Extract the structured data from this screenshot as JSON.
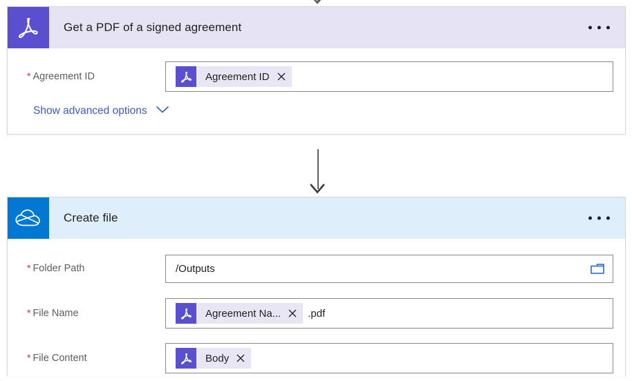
{
  "flow": {
    "cards": [
      {
        "id": "get-pdf-signed-agreement",
        "title": "Get a PDF of a signed agreement",
        "connector": "adobe-acrobat-sign",
        "icon_name": "adobe-acrobat-sign-icon",
        "header_bg": "#e6e3f4",
        "icon_bg": "#5a4fcf",
        "menu_label": "More commands",
        "fields": [
          {
            "label": "Agreement ID",
            "required": true,
            "required_mark": "*",
            "kind": "token",
            "token": {
              "text": "Agreement ID",
              "icon_name": "adobe-acrobat-sign-icon",
              "remove_label": "×"
            }
          }
        ],
        "advanced_link": {
          "label": "Show advanced options",
          "chevron": "chevron-down-icon"
        }
      },
      {
        "id": "create-file",
        "title": "Create file",
        "connector": "onedrive-for-business",
        "icon_name": "onedrive-cloud-icon",
        "header_bg": "#deeefa",
        "icon_bg": "#0078d4",
        "menu_label": "More commands",
        "fields": [
          {
            "label": "Folder Path",
            "required": true,
            "required_mark": "*",
            "kind": "text",
            "value": "/Outputs",
            "placeholder": "",
            "trailing_icon": "folder-picker-icon"
          },
          {
            "label": "File Name",
            "required": true,
            "required_mark": "*",
            "kind": "token",
            "token": {
              "text": "Agreement Na...",
              "icon_name": "adobe-acrobat-sign-icon",
              "remove_label": "×"
            },
            "suffix": ".pdf"
          },
          {
            "label": "File Content",
            "required": true,
            "required_mark": "*",
            "kind": "token",
            "token": {
              "text": "Body",
              "icon_name": "adobe-acrobat-sign-icon",
              "remove_label": "×"
            }
          }
        ]
      }
    ],
    "colors": {
      "accent_purple": "#5a4fcf",
      "accent_blue": "#0078d4",
      "link_blue": "#3b5fc0",
      "required_red": "#c4314b",
      "label_gray": "#605e5c",
      "token_bg": "#e8e6f4",
      "arrow_gray": "#605e5c"
    }
  }
}
